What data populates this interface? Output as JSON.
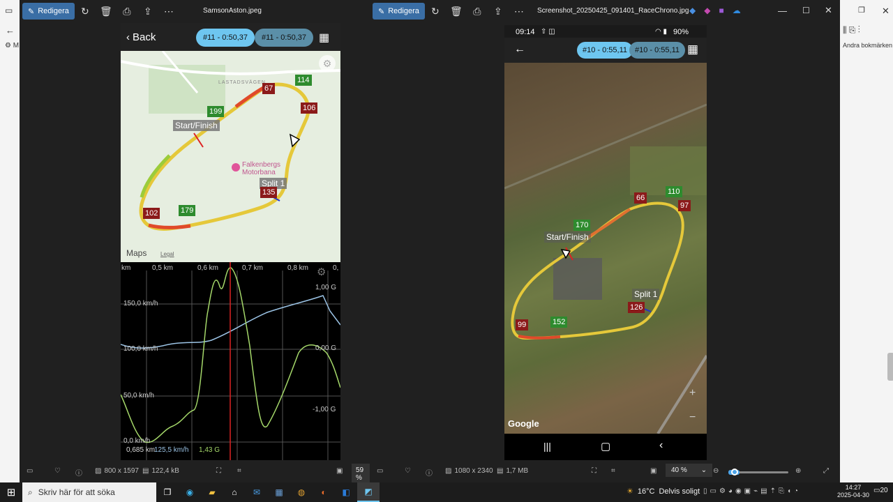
{
  "left_window": {
    "edit_label": "Redigera",
    "title": "SamsonAston.jpeg",
    "phone": {
      "back_label": "Back",
      "lap_a": "#11 - 0:50,37",
      "lap_b": "#11 - 0:50,37",
      "map": {
        "road_label": "LASTADSVÄGEN",
        "poi_label_1": "Falkenbergs",
        "poi_label_2": "Motorbana",
        "start_finish": "Start/Finish",
        "split": "Split 1",
        "markers": [
          {
            "text": "67",
            "kind": "red"
          },
          {
            "text": "114",
            "kind": "green"
          },
          {
            "text": "106",
            "kind": "red"
          },
          {
            "text": "199",
            "kind": "green"
          },
          {
            "text": "135",
            "kind": "red"
          },
          {
            "text": "102",
            "kind": "red"
          },
          {
            "text": "179",
            "kind": "green"
          }
        ],
        "maps_brand": "Maps",
        "legal": "Legal"
      },
      "graph": {
        "distance_ticks": [
          "km",
          "0,5 km",
          "0,6 km",
          "0,7 km",
          "0,8 km",
          "0,"
        ],
        "speed_ticks": [
          "150,0 km/h",
          "100,0 km/h",
          "50,0 km/h",
          "0,0 km/h"
        ],
        "g_ticks": [
          "1,00 G",
          "0,00 G",
          "-1,00 G"
        ],
        "readout_distance": "0,685 km",
        "readout_speed": "125,5 km/h",
        "readout_g": "1,43 G"
      }
    },
    "status": {
      "dimensions": "800 x 1597",
      "size": "122,4 kB",
      "zoom": "59 %"
    }
  },
  "right_window": {
    "edit_label": "Redigera",
    "title": "Screenshot_20250425_091401_RaceChrono.jpg",
    "phone": {
      "clock": "09:14",
      "battery": "90%",
      "lap_a": "#10 - 0:55,11",
      "lap_b": "#10 - 0:55,11",
      "map": {
        "start_finish": "Start/Finish",
        "split": "Split 1",
        "markers": [
          {
            "text": "66",
            "kind": "red"
          },
          {
            "text": "110",
            "kind": "green"
          },
          {
            "text": "97",
            "kind": "red"
          },
          {
            "text": "170",
            "kind": "green"
          },
          {
            "text": "126",
            "kind": "red"
          },
          {
            "text": "99",
            "kind": "red"
          },
          {
            "text": "152",
            "kind": "green"
          }
        ],
        "google": "Google"
      }
    },
    "status": {
      "dimensions": "1080 x 2340",
      "size": "1,7 MB",
      "zoom": "40 %"
    }
  },
  "background": {
    "bookmarks": "Andra bokmärken",
    "left_m": "M"
  },
  "taskbar": {
    "search_placeholder": "Skriv här för att söka",
    "weather_temp": "16°C",
    "weather_text": "Delvis soligt",
    "time": "14:27",
    "date": "2025-04-30",
    "notif": "20"
  },
  "colors": {
    "accent": "#3a6ea5",
    "pill_light": "#6ec6f0",
    "pill_dark": "#5b8fa8",
    "marker_red": "#8b1a1a",
    "marker_green": "#2e8b2e"
  }
}
